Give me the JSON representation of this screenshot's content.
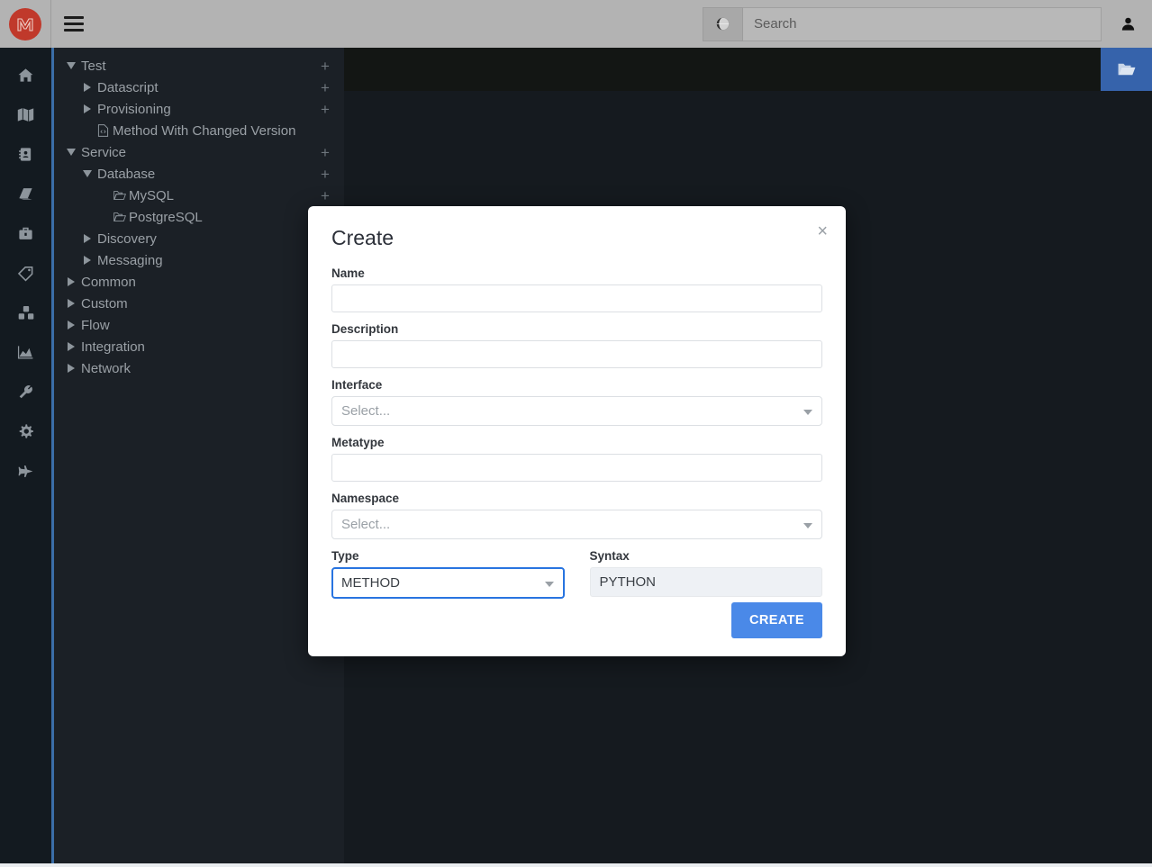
{
  "topbar": {
    "logo_letter": "M",
    "logo_color": "#c0392b",
    "menu_icon": "hamburger-icon",
    "globe_icon": "globe-icon",
    "search_placeholder": "Search",
    "search_value": "",
    "user_icon": "user-icon"
  },
  "rail": {
    "items": [
      {
        "icon": "home-icon"
      },
      {
        "icon": "map-icon"
      },
      {
        "icon": "address-book-icon"
      },
      {
        "icon": "book-icon"
      },
      {
        "icon": "briefcase-icon"
      },
      {
        "icon": "tag-icon"
      },
      {
        "icon": "cubes-icon"
      },
      {
        "icon": "chart-area-icon"
      },
      {
        "icon": "wrench-icon"
      },
      {
        "icon": "gear-icon"
      },
      {
        "icon": "plane-icon"
      }
    ]
  },
  "tree": {
    "items": [
      {
        "label": "Test",
        "indent": 0,
        "caret": "down",
        "icon": null,
        "plus": "+"
      },
      {
        "label": "Datascript",
        "indent": 1,
        "caret": "right",
        "icon": null,
        "plus": "+"
      },
      {
        "label": "Provisioning",
        "indent": 1,
        "caret": "right",
        "icon": null,
        "plus": "+"
      },
      {
        "label": "Method With Changed Version",
        "indent": 1,
        "caret": "none",
        "icon": "file-code-icon",
        "plus": ""
      },
      {
        "label": "Service",
        "indent": 0,
        "caret": "down",
        "icon": null,
        "plus": "+"
      },
      {
        "label": "Database",
        "indent": 1,
        "caret": "down",
        "icon": null,
        "plus": "+"
      },
      {
        "label": "MySQL",
        "indent": 2,
        "caret": "none",
        "icon": "folder-open-icon",
        "plus": "+"
      },
      {
        "label": "PostgreSQL",
        "indent": 2,
        "caret": "none",
        "icon": "folder-open-icon",
        "plus": ""
      },
      {
        "label": "Discovery",
        "indent": 1,
        "caret": "right",
        "icon": null,
        "plus": ""
      },
      {
        "label": "Messaging",
        "indent": 1,
        "caret": "right",
        "icon": null,
        "plus": ""
      },
      {
        "label": "Common",
        "indent": 0,
        "caret": "right",
        "icon": null,
        "plus": ""
      },
      {
        "label": "Custom",
        "indent": 0,
        "caret": "right",
        "icon": null,
        "plus": ""
      },
      {
        "label": "Flow",
        "indent": 0,
        "caret": "right",
        "icon": null,
        "plus": ""
      },
      {
        "label": "Integration",
        "indent": 0,
        "caret": "right",
        "icon": null,
        "plus": ""
      },
      {
        "label": "Network",
        "indent": 0,
        "caret": "right",
        "icon": null,
        "plus": ""
      }
    ]
  },
  "content": {
    "folder_button_icon": "folder-open-icon"
  },
  "modal": {
    "title": "Create",
    "close_label": "×",
    "fields": {
      "name": {
        "label": "Name",
        "value": "",
        "placeholder": ""
      },
      "description": {
        "label": "Description",
        "value": "",
        "placeholder": ""
      },
      "interface": {
        "label": "Interface",
        "value": "Select...",
        "options": [
          "Select..."
        ]
      },
      "metatype": {
        "label": "Metatype",
        "value": "",
        "placeholder": ""
      },
      "namespace": {
        "label": "Namespace",
        "value": "Select...",
        "options": [
          "Select..."
        ]
      },
      "type": {
        "label": "Type",
        "value": "METHOD",
        "options": [
          "METHOD"
        ]
      },
      "syntax": {
        "label": "Syntax",
        "value": "PYTHON",
        "readonly": true
      }
    },
    "submit_label": "CREATE",
    "accent_color": "#4a89e8",
    "focus_color": "#2874e0"
  }
}
